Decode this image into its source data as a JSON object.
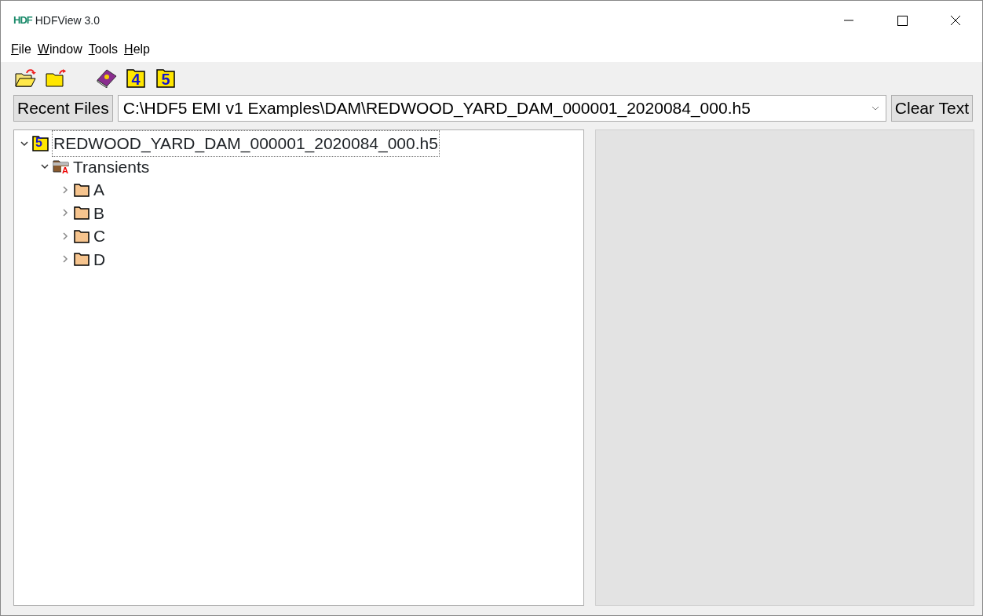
{
  "window": {
    "logo": "HDF",
    "title": "HDFView 3.0"
  },
  "menu": [
    {
      "label": "File"
    },
    {
      "label": "Window"
    },
    {
      "label": "Tools"
    },
    {
      "label": "Help"
    }
  ],
  "toolbar": [
    {
      "kind": "open"
    },
    {
      "kind": "close"
    },
    {
      "kind": "gap"
    },
    {
      "kind": "help"
    },
    {
      "kind": "numbered",
      "label": "4"
    },
    {
      "kind": "numbered",
      "label": "5"
    }
  ],
  "recent": {
    "button": "Recent Files",
    "value": "C:\\HDF5 EMI v1 Examples\\DAM\\REDWOOD_YARD_DAM_000001_2020084_000.h5",
    "clear": "Clear Text"
  },
  "tree": [
    {
      "label": "REDWOOD_YARD_DAM_000001_2020084_000.h5",
      "kind": "file",
      "badge": "5",
      "expanded": true,
      "selected": true,
      "children": [
        {
          "label": "Transients",
          "kind": "attrgroup",
          "badge": "A",
          "expanded": true,
          "selected": false,
          "children": [
            {
              "label": "A",
              "kind": "group",
              "expanded": false,
              "selected": false
            },
            {
              "label": "B",
              "kind": "group",
              "expanded": false,
              "selected": false
            },
            {
              "label": "C",
              "kind": "group",
              "expanded": false,
              "selected": false
            },
            {
              "label": "D",
              "kind": "group",
              "expanded": false,
              "selected": false
            }
          ]
        }
      ]
    }
  ]
}
